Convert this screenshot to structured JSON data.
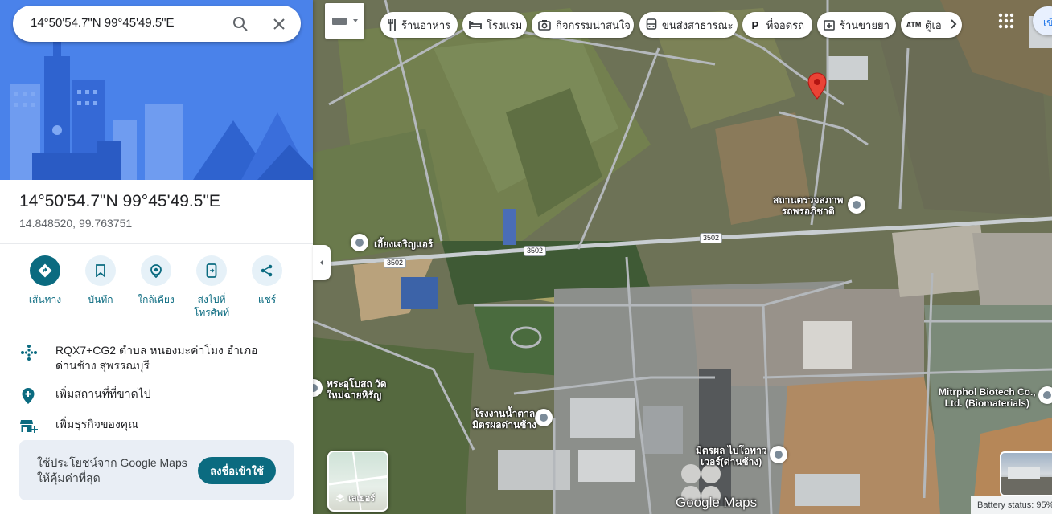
{
  "search": {
    "value": "14°50'54.7\"N 99°45'49.5\"E",
    "search_icon": "search-icon",
    "close_icon": "close-icon"
  },
  "place": {
    "title": "14°50'54.7\"N 99°45'49.5\"E",
    "coords": "14.848520, 99.763751"
  },
  "actions": [
    {
      "label": "เส้นทาง",
      "icon": "directions-icon"
    },
    {
      "label": "บันทึก",
      "icon": "bookmark-icon"
    },
    {
      "label": "ใกล้เคียง",
      "icon": "nearby-icon"
    },
    {
      "label": "ส่งไปที่โทรศัพท์",
      "icon": "send-to-phone-icon"
    },
    {
      "label": "แชร์",
      "icon": "share-icon"
    }
  ],
  "info": {
    "plus_code": "RQX7+CG2 ตำบล หนองมะค่าโมง อำเภอด่านช้าง สุพรรณบุรี",
    "add_missing_place": "เพิ่มสถานที่ที่ขาดไป",
    "add_business": "เพิ่มธุรกิจของคุณ"
  },
  "promo": {
    "text": "ใช้ประโยชน์จาก Google Maps ให้คุ้มค่าที่สุด",
    "button": "ลงชื่อเข้าใช้"
  },
  "chips": [
    {
      "label": "ร้านอาหาร",
      "icon": "restaurant-icon"
    },
    {
      "label": "โรงแรม",
      "icon": "hotel-icon"
    },
    {
      "label": "กิจกรรมน่าสนใจ",
      "icon": "camera-icon"
    },
    {
      "label": "ขนส่งสาธารณะ",
      "icon": "transit-icon"
    },
    {
      "label": "ที่จอดรถ",
      "icon": "parking-icon"
    },
    {
      "label": "ร้านขายยา",
      "icon": "pharmacy-icon"
    },
    {
      "label": "ตู้เอ",
      "icon": "atm-icon"
    }
  ],
  "map": {
    "pois": [
      {
        "label": "สถานตรวจสภาพ\nรถพรอภิชาติ"
      },
      {
        "label": "เอี้ยงเจริญแอร์"
      },
      {
        "label": "พระอุโบสถ วัด\nใหม่ฉายหิรัญ"
      },
      {
        "label": "โรงงานน้ำตาล\nมิตรผลด่านช้าง"
      },
      {
        "label": "มิตรผล ไบโอพาว\nเวอร์(ด่านช้าง)"
      },
      {
        "label": "Mitrphol Biotech Co.,\nLtd. (Biomaterials)"
      }
    ],
    "roads": [
      "3502",
      "3502",
      "3502"
    ],
    "layers_label": "เลเยอร์",
    "logo": "Google Maps",
    "account_text": "เข้"
  },
  "battery_status": "Battery status: 95%",
  "colors": {
    "accent": "#0b6b80",
    "hero_blue": "#4b83ec",
    "pin_red": "#ea4335"
  }
}
